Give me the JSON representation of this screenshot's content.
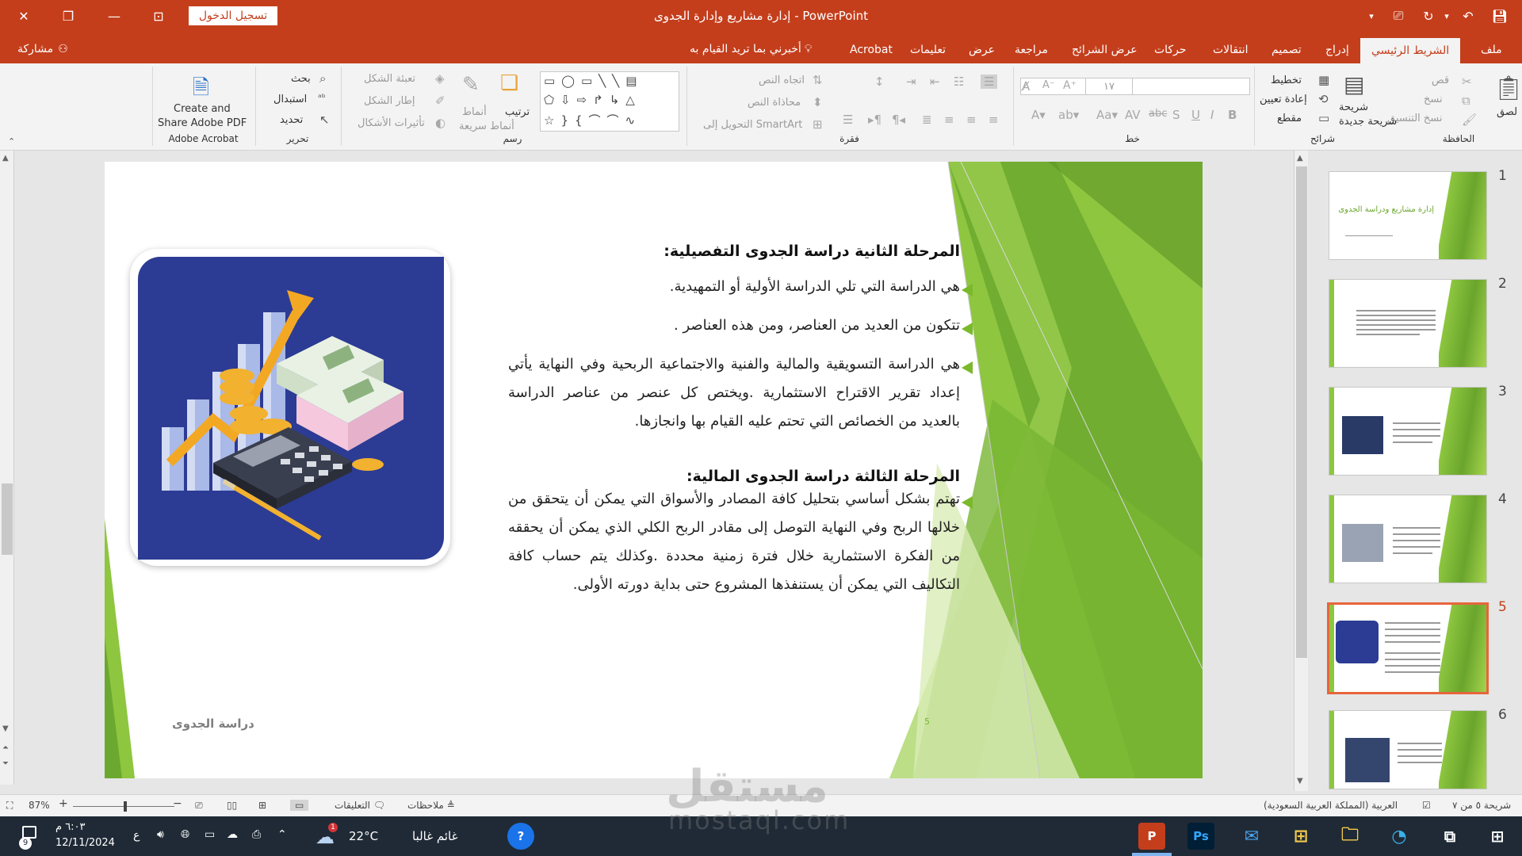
{
  "titlebar": {
    "title": "إدارة مشاريع وإدارة الجدوى  -  PowerPoint",
    "signin": "تسجيل الدخول",
    "close_icon": "close-icon",
    "restore_icon": "restore-icon",
    "minimize_icon": "minimize-icon"
  },
  "tabs": {
    "file": "ملف",
    "home": "الشريط الرئيسي",
    "insert": "إدراج",
    "design": "تصميم",
    "transitions": "انتقالات",
    "animations": "حركات",
    "slideshow": "عرض الشرائح",
    "review": "مراجعة",
    "view": "عرض",
    "help": "تعليمات",
    "acrobat": "Acrobat",
    "tellme": "أخبرني بما تريد القيام به",
    "share": "مشاركة"
  },
  "ribbon": {
    "clipboard": {
      "label": "الحافظة",
      "paste": "لصق",
      "cut": "قص",
      "copy": "نسخ",
      "format_painter": "نسخ التنسيق"
    },
    "slides": {
      "label": "شرائح",
      "new_slide": "شريحة جديدة",
      "layout": "تخطيط",
      "reset": "إعادة تعيين",
      "section": "مقطع"
    },
    "font": {
      "label": "خط",
      "size": "١٧"
    },
    "paragraph": {
      "label": "فقرة",
      "text_direction": "اتجاه النص",
      "align_text": "محاذاة النص",
      "smartart": "التحويل إلى SmartArt"
    },
    "drawing": {
      "label": "رسم",
      "arrange": "ترتيب",
      "quick_styles": "أنماط سريعة",
      "shape_fill": "تعبئة الشكل",
      "shape_outline": "إطار الشكل",
      "shape_effects": "تأثيرات الأشكال"
    },
    "editing": {
      "label": "تحرير",
      "find": "بحث",
      "replace": "استبدال",
      "select": "تحديد"
    },
    "acrobat": {
      "label": "Adobe Acrobat",
      "create_share_1": "Create and",
      "create_share_2": "Share Adobe PDF"
    }
  },
  "slide": {
    "heading1": "المرحلة الثانية دراسة الجدوى التفصيلية:",
    "bullet1": "هي الدراسة التي تلي الدراسة الأولية أو التمهيدية.",
    "bullet2": "تتكون من العديد من العناصر، ومن هذه العناصر .",
    "bullet3": "هي الدراسة التسويقية والمالية والفنية والاجتماعية الربحية وفي النهاية يأتي إعداد تقرير الاقتراح الاستثمارية .ويختص كل عنصر من عناصر الدراسة بالعديد من الخصائص التي تحتم عليه القيام بها وانجازها.",
    "heading2": "المرحلة الثالثة دراسة الجدوى المالية:",
    "bullet4": "تهتم بشكل أساسي بتحليل كافة المصادر والأسواق التي يمكن أن يتحقق من خلالها الربح وفي النهاية التوصل إلى مقادر الربح الكلي الذي يمكن أن يحققه من الفكرة الاستثمارية خلال فترة زمنية محددة .وكذلك يتم حساب كافة التكاليف التي يمكن أن يستنفذها المشروع حتى بداية دورته الأولى.",
    "footer": "دراسة الجدوى",
    "page_number": "5",
    "accent": "#7ab929"
  },
  "thumbnails": {
    "items": [
      {
        "num": "1",
        "title": "إدارة مشاريع ودراسة الجدوى"
      },
      {
        "num": "2",
        "title": ""
      },
      {
        "num": "3",
        "title": ""
      },
      {
        "num": "4",
        "title": ""
      },
      {
        "num": "5",
        "title": ""
      },
      {
        "num": "6",
        "title": ""
      }
    ],
    "active_index": 5
  },
  "statusbar": {
    "slide_of": "شريحة ٥ من ٧",
    "language": "العربية (المملكة العربية السعودية)",
    "notes": "ملاحظات",
    "comments": "التعليقات",
    "zoom": "87%"
  },
  "taskbar": {
    "weather_desc": "غائم غالبا",
    "temperature": "22°C",
    "weather_badge": "1",
    "time": "٦:٠٣ م",
    "date": "12/11/2024",
    "lang_indicator": "ع",
    "notification_count": "9"
  },
  "watermark": {
    "brand_ar": "مستقل",
    "brand_en": "mostaql.com"
  }
}
